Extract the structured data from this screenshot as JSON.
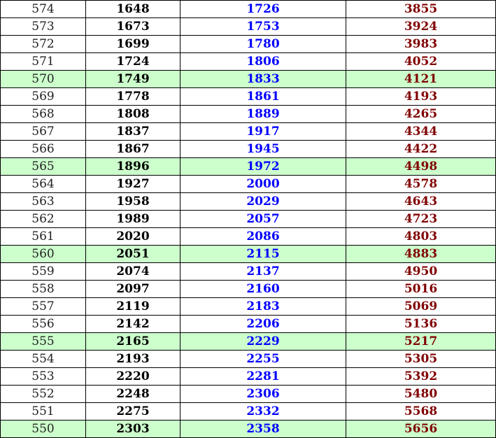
{
  "colors": {
    "highlight_row": "#ccffcc",
    "col1_text": "#222222",
    "col2_text": "#000000",
    "col3_text": "#0000ff",
    "col4_text": "#800000",
    "border": "#000000"
  },
  "rows": [
    {
      "score": "574",
      "a": "1648",
      "b": "1726",
      "c": "3855",
      "highlight": false
    },
    {
      "score": "573",
      "a": "1673",
      "b": "1753",
      "c": "3924",
      "highlight": false
    },
    {
      "score": "572",
      "a": "1699",
      "b": "1780",
      "c": "3983",
      "highlight": false
    },
    {
      "score": "571",
      "a": "1724",
      "b": "1806",
      "c": "4052",
      "highlight": false
    },
    {
      "score": "570",
      "a": "1749",
      "b": "1833",
      "c": "4121",
      "highlight": true
    },
    {
      "score": "569",
      "a": "1778",
      "b": "1861",
      "c": "4193",
      "highlight": false
    },
    {
      "score": "568",
      "a": "1808",
      "b": "1889",
      "c": "4265",
      "highlight": false
    },
    {
      "score": "567",
      "a": "1837",
      "b": "1917",
      "c": "4344",
      "highlight": false
    },
    {
      "score": "566",
      "a": "1867",
      "b": "1945",
      "c": "4422",
      "highlight": false
    },
    {
      "score": "565",
      "a": "1896",
      "b": "1972",
      "c": "4498",
      "highlight": true
    },
    {
      "score": "564",
      "a": "1927",
      "b": "2000",
      "c": "4578",
      "highlight": false
    },
    {
      "score": "563",
      "a": "1958",
      "b": "2029",
      "c": "4643",
      "highlight": false
    },
    {
      "score": "562",
      "a": "1989",
      "b": "2057",
      "c": "4723",
      "highlight": false
    },
    {
      "score": "561",
      "a": "2020",
      "b": "2086",
      "c": "4803",
      "highlight": false
    },
    {
      "score": "560",
      "a": "2051",
      "b": "2115",
      "c": "4883",
      "highlight": true
    },
    {
      "score": "559",
      "a": "2074",
      "b": "2137",
      "c": "4950",
      "highlight": false
    },
    {
      "score": "558",
      "a": "2097",
      "b": "2160",
      "c": "5016",
      "highlight": false
    },
    {
      "score": "557",
      "a": "2119",
      "b": "2183",
      "c": "5069",
      "highlight": false
    },
    {
      "score": "556",
      "a": "2142",
      "b": "2206",
      "c": "5136",
      "highlight": false
    },
    {
      "score": "555",
      "a": "2165",
      "b": "2229",
      "c": "5217",
      "highlight": true
    },
    {
      "score": "554",
      "a": "2193",
      "b": "2255",
      "c": "5305",
      "highlight": false
    },
    {
      "score": "553",
      "a": "2220",
      "b": "2281",
      "c": "5392",
      "highlight": false
    },
    {
      "score": "552",
      "a": "2248",
      "b": "2306",
      "c": "5480",
      "highlight": false
    },
    {
      "score": "551",
      "a": "2275",
      "b": "2332",
      "c": "5568",
      "highlight": false
    },
    {
      "score": "550",
      "a": "2303",
      "b": "2358",
      "c": "5656",
      "highlight": true
    }
  ]
}
